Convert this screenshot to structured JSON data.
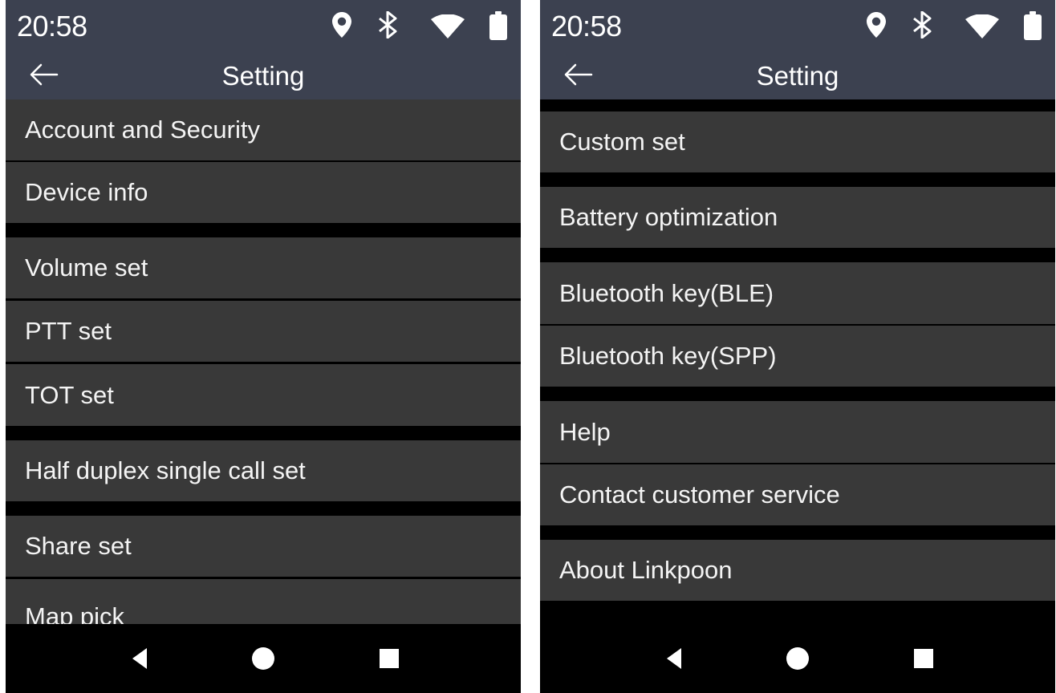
{
  "screens": [
    {
      "status": {
        "time": "20:58"
      },
      "header": {
        "title": "Setting",
        "back_icon": "arrow-left-icon"
      },
      "menu": [
        "Account and Security",
        "Device info",
        "Volume set",
        "PTT set",
        "TOT set",
        "Half duplex single call set",
        "Share set",
        "Map pick"
      ]
    },
    {
      "status": {
        "time": "20:58"
      },
      "header": {
        "title": "Setting",
        "back_icon": "arrow-left-icon"
      },
      "menu": [
        "Custom set",
        "Battery optimization",
        "Bluetooth key(BLE)",
        "Bluetooth key(SPP)",
        "Help",
        "Contact customer service",
        "About Linkpoon"
      ]
    }
  ],
  "status_icons": [
    "location-pin-icon",
    "bluetooth-icon",
    "wifi-icon",
    "battery-icon"
  ],
  "nav_icons": [
    "back-triangle-icon",
    "home-circle-icon",
    "recents-square-icon"
  ],
  "colors": {
    "status_bar": "#3c4150",
    "menu_item": "#393939",
    "divider": "#000000",
    "text": "#f4f4f4"
  }
}
